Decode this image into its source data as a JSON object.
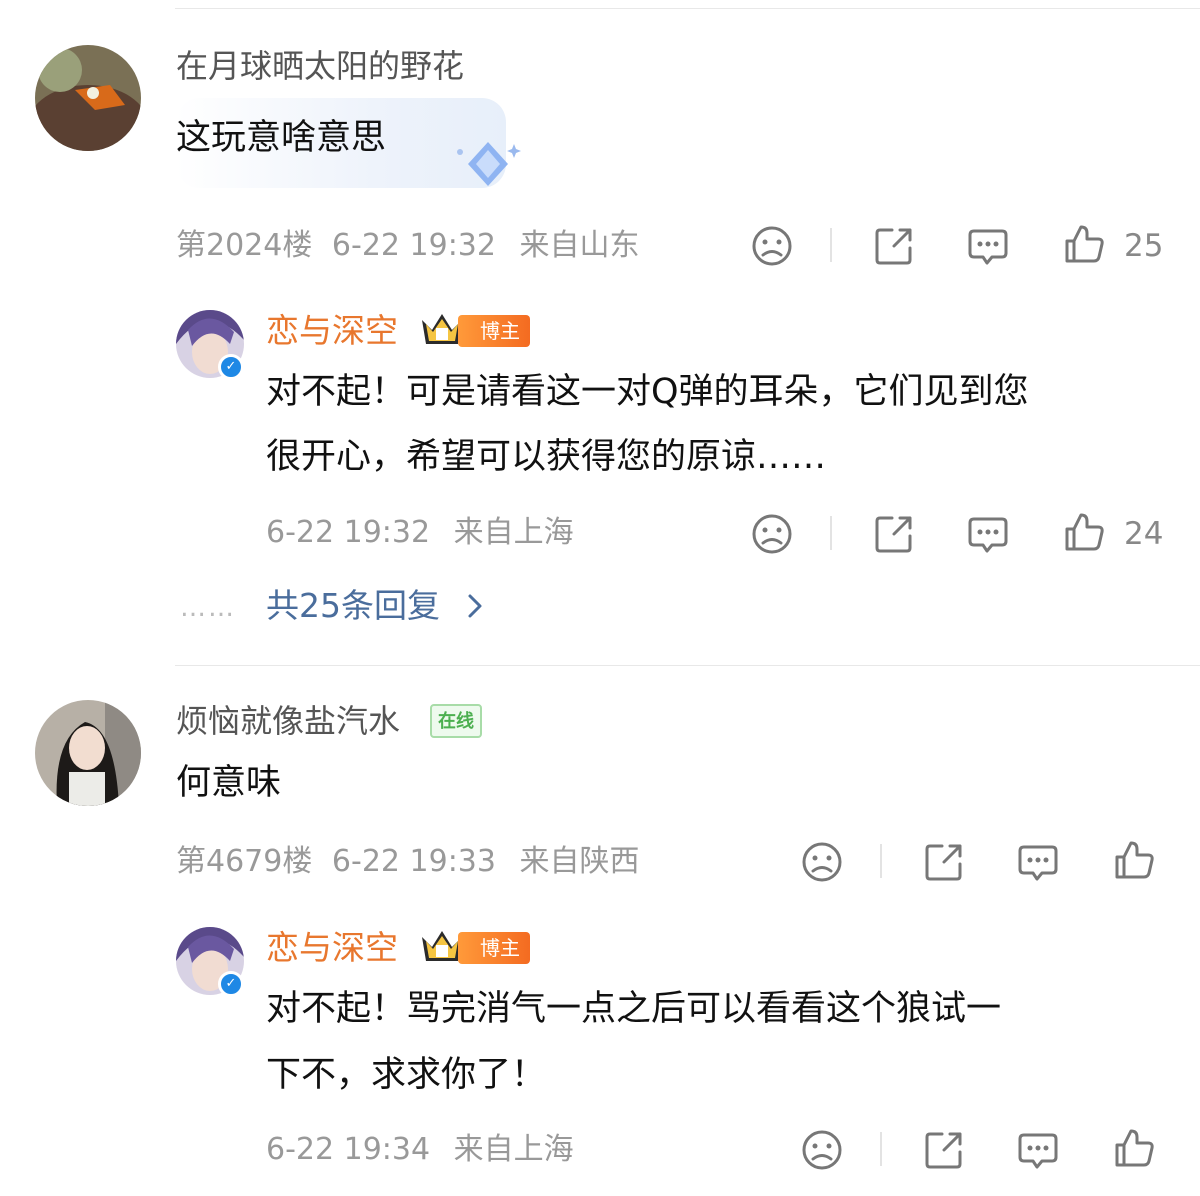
{
  "comments": [
    {
      "username": "在月球晒太阳的野花",
      "text": "这玩意啥意思",
      "floor": "第2024楼",
      "time": "6-22 19:32",
      "location": "来自山东",
      "like_count": "25",
      "reply": {
        "username": "恋与深空",
        "badge": "博主",
        "text_line1": "对不起！可是请看这一对Q弹的耳朵，它们见到您",
        "text_line2": "很开心，希望可以获得您的原谅……",
        "time": "6-22 19:32",
        "location": "来自上海",
        "like_count": "24"
      },
      "more_dots": "……",
      "more_replies": "共25条回复"
    },
    {
      "username": "烦恼就像盐汽水",
      "online_badge": "在线",
      "text": "何意味",
      "floor": "第4679楼",
      "time": "6-22 19:33",
      "location": "来自陕西",
      "reply": {
        "username": "恋与深空",
        "badge": "博主",
        "text_line1": "对不起！骂完消气一点之后可以看看这个狼试一",
        "text_line2": "下不，求求你了！",
        "time": "6-22 19:34",
        "location": "来自上海"
      }
    }
  ],
  "colors": {
    "blogger_name": "#e8772e",
    "link": "#4a6d9c",
    "meta": "#999999",
    "verified": "#1e88e5"
  },
  "icons": [
    "frown-icon",
    "share-icon",
    "comment-icon",
    "thumbs-up-icon",
    "verified-icon",
    "crown-icon",
    "chevron-right-icon"
  ]
}
